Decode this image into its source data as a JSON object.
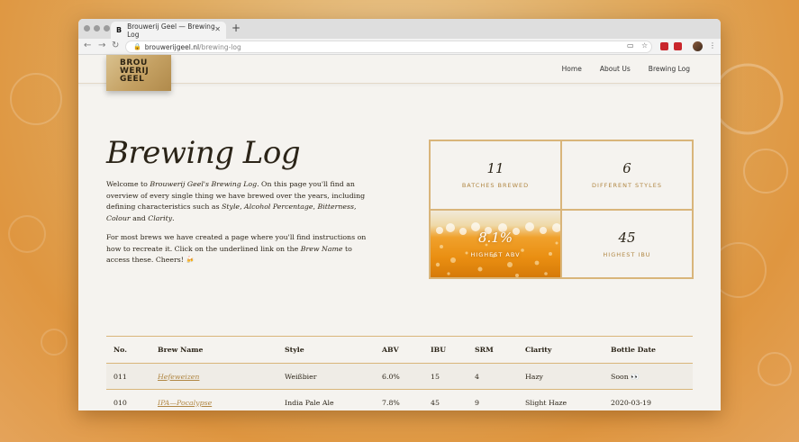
{
  "browser": {
    "tab_title": "Brouwerij Geel — Brewing Log",
    "favicon_letter": "B",
    "url_domain": "brouwerijgeel.nl",
    "url_path": "/brewing-log"
  },
  "site": {
    "logo_lines": [
      "BROU",
      "WERIJ",
      "GEEL"
    ],
    "nav": [
      "Home",
      "About Us",
      "Brewing Log"
    ]
  },
  "page": {
    "title": "Brewing Log",
    "intro": {
      "p1_pre": "Welcome to ",
      "p1_em1": "Brouwerij Geel's Brewing Log",
      "p1_mid": ". On this page you'll find an overview of every single thing we have brewed over the years, including defining characteristics such as ",
      "p1_em2": "Style",
      "p1_em3": "Alcohol Percentage",
      "p1_em4": "Bitterness",
      "p1_em5": "Colour",
      "p1_and": " and ",
      "p1_em6": "Clarity",
      "p1_end": ".",
      "p2_pre": "For most brews we have created a page where you'll find instructions on how to recreate it. Click on the underlined link on the ",
      "p2_em": "Brew Name",
      "p2_post": " to access these. Cheers! 🍻"
    },
    "stats": [
      {
        "value": "11",
        "label": "BATCHES BREWED"
      },
      {
        "value": "6",
        "label": "DIFFERENT STYLES"
      },
      {
        "value": "8.1%",
        "label": "HIGHEST ABV"
      },
      {
        "value": "45",
        "label": "HIGHEST IBU"
      }
    ]
  },
  "table": {
    "headers": [
      "No.",
      "Brew Name",
      "Style",
      "ABV",
      "IBU",
      "SRM",
      "Clarity",
      "Bottle Date"
    ],
    "rows": [
      [
        "011",
        "Hefeweizen",
        "Weißbier",
        "6.0%",
        "15",
        "4",
        "Hazy",
        "Soon 👀"
      ],
      [
        "010",
        "IPA—Pocalypse",
        "India Pale Ale",
        "7.8%",
        "45",
        "9",
        "Slight Haze",
        "2020-03-19"
      ]
    ]
  },
  "colors": {
    "accent_gold": "#b08642",
    "border_gold": "#d9b57a",
    "text_dark": "#2b2418",
    "beer_orange": "#ea8f12"
  }
}
